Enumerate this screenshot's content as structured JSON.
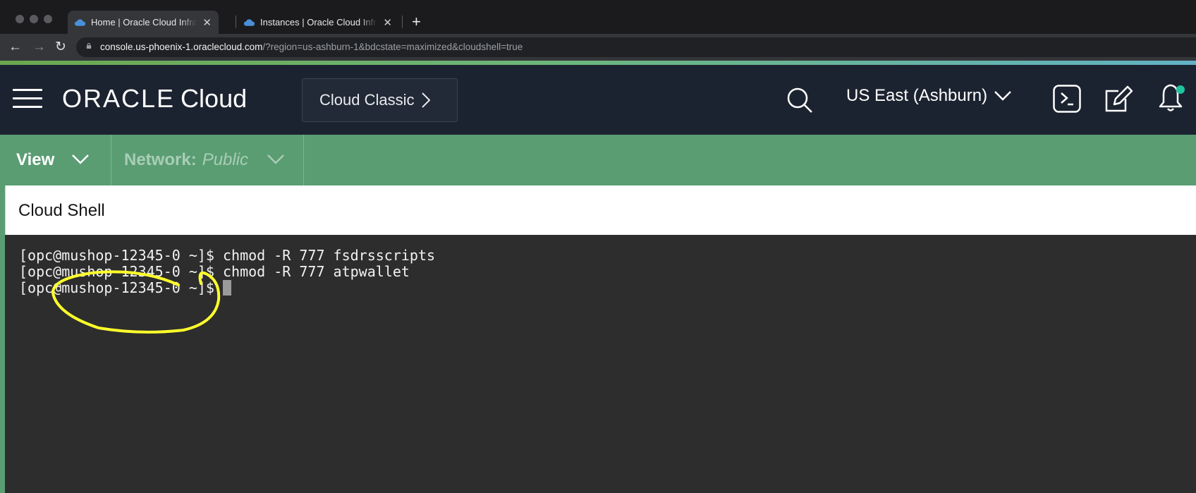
{
  "browser": {
    "tabs": [
      {
        "title": "Home | Oracle Cloud Infrastructure",
        "active": true
      },
      {
        "title": "Instances | Oracle Cloud Infrastructure",
        "active": false
      }
    ],
    "new_tab": "+",
    "url_host": "console.us-phoenix-1.oraclecloud.com",
    "url_path": "/?region=us-ashburn-1&bdcstate=maximized&cloudshell=true"
  },
  "header": {
    "logo_oracle": "ORACLE",
    "logo_cloud": "Cloud",
    "classic_button": "Cloud Classic",
    "region": "US East (Ashburn)",
    "notification_dot_color": "#1fc39e"
  },
  "context_bar": {
    "view_label": "View",
    "network_label": "Network:",
    "network_value": "Public"
  },
  "cloud_shell": {
    "title": "Cloud Shell",
    "lines": [
      {
        "prompt": "[opc@mushop-12345-0 ~]$",
        "command": " chmod -R 777 fsdrsscripts"
      },
      {
        "prompt": "[opc@mushop-12345-0 ~]$",
        "command": " chmod -R 777 atpwallet"
      },
      {
        "prompt": "[opc@mushop-12345-0 ~]$",
        "command": ""
      }
    ]
  },
  "annotation": {
    "color": "#ffff2b",
    "shape": "hand-drawn-circle"
  },
  "colors": {
    "header_bg": "#1c2330",
    "context_bar_bg": "#5a9d73",
    "terminal_bg": "#2d2d2d"
  }
}
